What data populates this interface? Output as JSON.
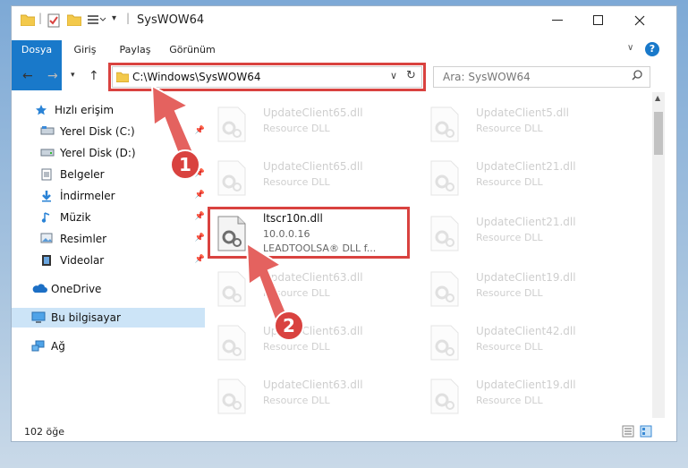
{
  "window": {
    "title": "SysWOW64"
  },
  "ribbon": {
    "tabs": [
      "Dosya",
      "Giriş",
      "Paylaş",
      "Görünüm"
    ]
  },
  "address": {
    "path": "C:\\Windows\\SysWOW64"
  },
  "search": {
    "placeholder": "Ara: SysWOW64"
  },
  "sidebar": {
    "items": [
      {
        "label": "Hızlı erişim"
      },
      {
        "label": "Yerel Disk (C:)"
      },
      {
        "label": "Yerel Disk (D:)"
      },
      {
        "label": "Belgeler"
      },
      {
        "label": "İndirmeler"
      },
      {
        "label": "Müzik"
      },
      {
        "label": "Resimler"
      },
      {
        "label": "Videolar"
      },
      {
        "label": "OneDrive"
      },
      {
        "label": "Bu bilgisayar"
      },
      {
        "label": "Ağ"
      }
    ]
  },
  "files": {
    "left": [
      {
        "name": "UpdateClient65.dll",
        "desc": "Resource DLL"
      },
      {
        "name": "UpdateClient65.dll",
        "desc": "Resource DLL"
      },
      {
        "name": "ltscr10n.dll",
        "version": "10.0.0.16",
        "desc": "LEADTOOLSA® DLL f..."
      },
      {
        "name": "UpdateClient63.dll",
        "desc": "Resource DLL"
      },
      {
        "name": "UpdateClient63.dll",
        "desc": "Resource DLL"
      },
      {
        "name": "UpdateClient63.dll",
        "desc": "Resource DLL"
      }
    ],
    "right": [
      {
        "name": "UpdateClient5.dll",
        "desc": "Resource DLL"
      },
      {
        "name": "UpdateClient21.dll",
        "desc": "Resource DLL"
      },
      {
        "name": "UpdateClient21.dll",
        "desc": "Resource DLL"
      },
      {
        "name": "UpdateClient19.dll",
        "desc": "Resource DLL"
      },
      {
        "name": "UpdateClient42.dll",
        "desc": "Resource DLL"
      },
      {
        "name": "UpdateClient19.dll",
        "desc": "Resource DLL"
      }
    ]
  },
  "status": {
    "count": "102 öğe"
  },
  "annotations": {
    "step1": "1",
    "step2": "2"
  },
  "colors": {
    "accent": "#1979ca",
    "highlight": "#d9423f",
    "selected": "#cce4f7"
  }
}
